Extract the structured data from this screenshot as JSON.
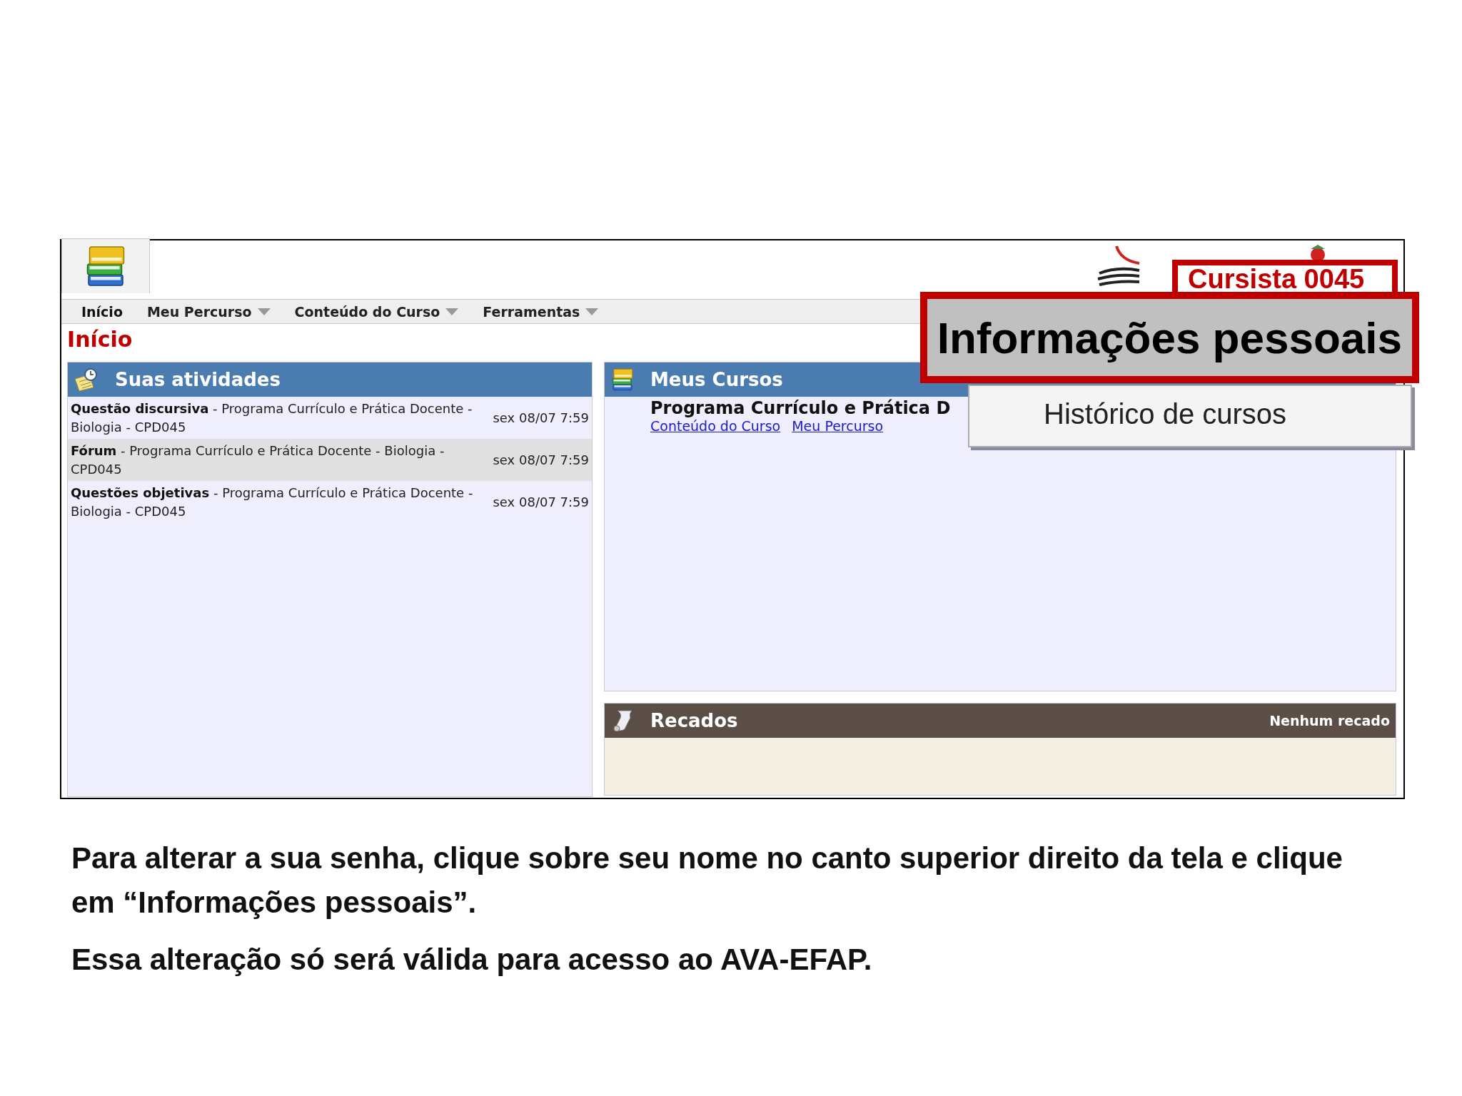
{
  "screen": {
    "menu": [
      {
        "label": "Início",
        "selected": true,
        "has_menu": false
      },
      {
        "label": "Meu Percurso",
        "selected": false,
        "has_menu": true
      },
      {
        "label": "Conteúdo do Curso",
        "selected": false,
        "has_menu": true
      },
      {
        "label": "Ferramentas",
        "selected": false,
        "has_menu": true
      }
    ],
    "user_name": "Cursista 0045",
    "page_title": "Início",
    "activities": {
      "title": "Suas atividades",
      "items": [
        {
          "description": "**Questão discursiva** - Programa Currículo e Prática Docente - Biologia - CPD045",
          "date": "sex 08/07 7:59"
        },
        {
          "description": "**Fórum** - Programa Currículo e Prática Docente - Biologia - CPD045",
          "date": "sex 08/07 7:59"
        },
        {
          "description": "**Questões objetivas** - Programa Currículo e Prática Docente - Biologia - CPD045",
          "date": "sex 08/07 7:59"
        }
      ]
    },
    "courses": {
      "title": "Meus Cursos",
      "items": [
        {
          "name": "Programa Currículo e Prática D",
          "links": [
            "Conteúdo do Curso",
            "Meu Percurso"
          ]
        }
      ]
    },
    "messages": {
      "title": "Recados",
      "status": "Nenhum recado"
    },
    "user_menu": [
      {
        "label": "Informações pessoais",
        "highlighted": true
      },
      {
        "label": "Histórico de cursos",
        "highlighted": false
      }
    ]
  },
  "caption": [
    "Para alterar a sua senha, clique sobre seu nome no canto superior direito da tela e clique em “Informações pessoais”.",
    "Essa alteração só será válida para acesso ao AVA-EFAP."
  ]
}
